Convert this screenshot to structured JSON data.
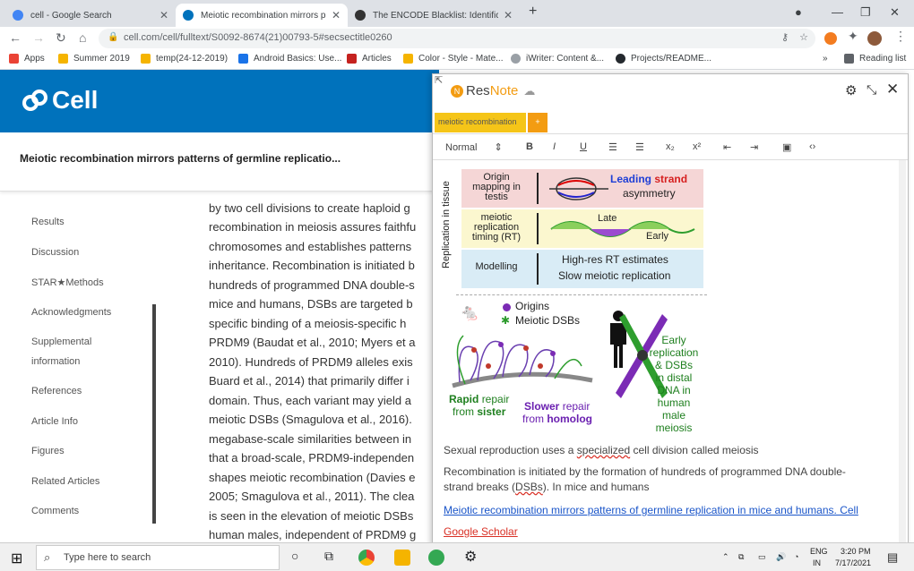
{
  "browser": {
    "tabs": [
      {
        "title": "cell - Google Search",
        "color": "#4285f4"
      },
      {
        "title": "Meiotic recombination mirrors p…",
        "color": "#0072bc"
      },
      {
        "title": "The ENCODE Blacklist: Identificat…",
        "color": "#333333"
      }
    ],
    "new_tab": "+",
    "url": "cell.com/cell/fulltext/S0092-8674(21)00793-5#secsectitle0260",
    "bookmarks": [
      "Apps",
      "Summer 2019",
      "temp(24-12-2019)",
      "Android Basics: Use...",
      "Articles",
      "Color - Style - Mate...",
      "iWriter: Content &...",
      "Projects/README...",
      "»",
      "Reading list"
    ]
  },
  "page": {
    "logo": "Cell",
    "article_title": "Meiotic recombination mirrors patterns of germline replicatio...",
    "sidebar": [
      "Results",
      "Discussion",
      "STAR★Methods",
      "Acknowledgments",
      "Supplemental",
      "information",
      "References",
      "Article Info",
      "Figures",
      "Related Articles",
      "Comments"
    ],
    "body_lines": [
      "by two cell divisions to create haploid g",
      "recombination in meiosis assures faithfu",
      "chromosomes and establishes patterns",
      "inheritance. Recombination is initiated b",
      "hundreds of programmed DNA double-s",
      "mice and humans, DSBs are targeted b",
      "specific binding of a meiosis-specific h",
      "PRDM9 (Baudat et al., 2010; Myers et a",
      "2010). Hundreds of PRDM9 alleles exis",
      "Buard et al., 2014) that primarily differ i",
      "domain. Thus, each variant may yield a",
      "meiotic DSBs (Smagulova et al., 2016).",
      "megabase-scale similarities between in",
      "that a broad-scale, PRDM9-independen",
      "shapes meiotic recombination (Davies e",
      "2005; Smagulova et al., 2011). The clea",
      "is seen in the elevation of meiotic DSBs",
      "human males, independent of PRDM9 g"
    ]
  },
  "resnote": {
    "brand_a": "Res",
    "brand_b": "Note",
    "tab_label": "meiotic recombination",
    "tab_add": "+",
    "format_select": "Normal",
    "figure": {
      "side_label": "Replication in tissue",
      "row1_label": "Origin mapping in testis",
      "row1_text_a": "Leading",
      "row1_text_b": "strand",
      "row1_text_c": "asymmetry",
      "row2_label": "meiotic replication timing (RT)",
      "row2_late": "Late",
      "row2_early": "Early",
      "row3_label": "Modelling",
      "row3_line1": "High-res RT estimates",
      "row3_line2": "Slow meiotic replication",
      "legend_origins": "Origins",
      "legend_dsbs": "Meiotic DSBs",
      "rapid": "Rapid",
      "rapid_rest": "repair",
      "from_sister_a": "from",
      "from_sister_b": "sister",
      "slower": "Slower",
      "slower_rest": "repair",
      "from_homolog_a": "from",
      "from_homolog_b": "homolog",
      "early_text": [
        "Early",
        "replication",
        "& DSBs",
        "in distal",
        "DNA in",
        "human male",
        "meiosis"
      ]
    },
    "notes": {
      "line1_a": "Sexual reproduction uses a",
      "line1_b": "specialized",
      "line1_c": "cell division called meiosis",
      "line2": "Recombination is initiated by the formation of hundreds of programmed DNA double-",
      "line3_a": "strand breaks (",
      "line3_b": "DSBs",
      "line3_c": "). In mice and humans",
      "link1": "Meiotic recombination mirrors patterns of germline replication in mice and humans. Cell",
      "link2": "Google Scholar"
    }
  },
  "taskbar": {
    "search_placeholder": "Type here to search",
    "lang1": "ENG",
    "lang2": "IN",
    "time": "3:20 PM",
    "date": "7/17/2021"
  }
}
